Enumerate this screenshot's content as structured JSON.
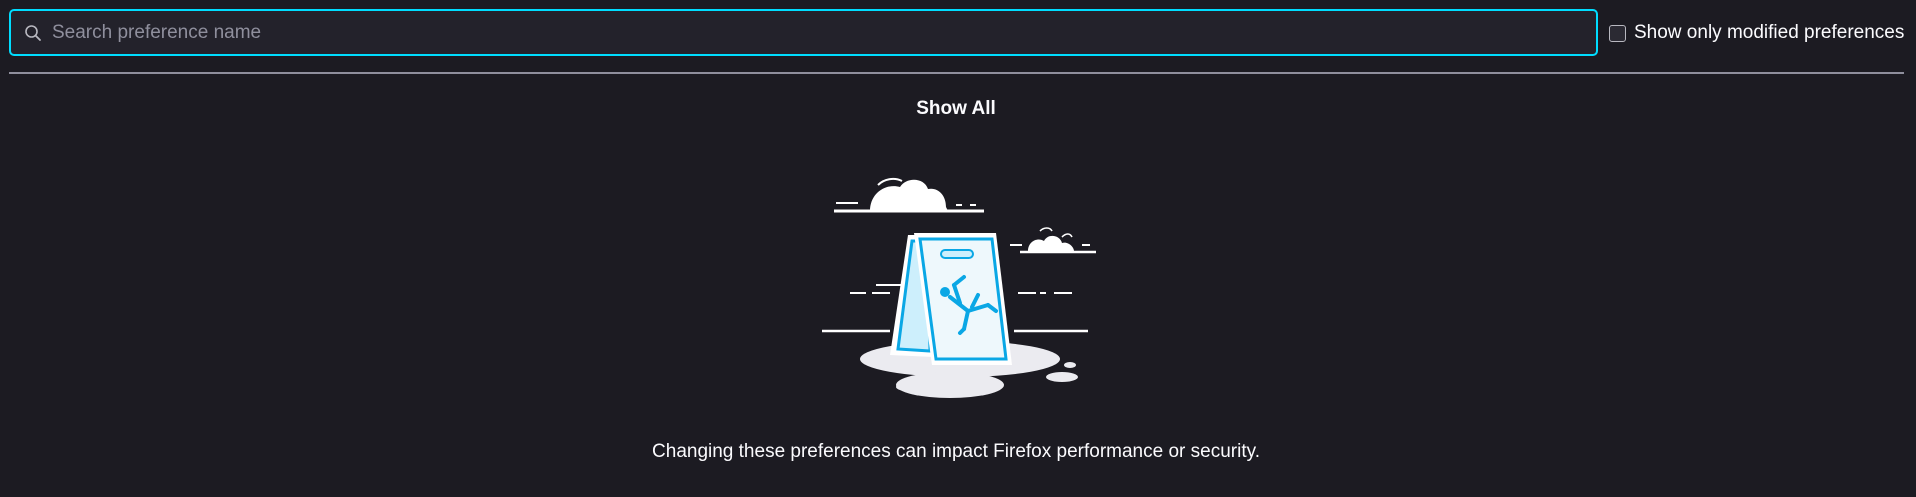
{
  "search": {
    "placeholder": "Search preference name",
    "value": ""
  },
  "filter": {
    "modified_only_label": "Show only modified preferences",
    "checked": false
  },
  "actions": {
    "show_all_label": "Show All"
  },
  "warning": {
    "text": "Changing these preferences can impact Firefox performance or security."
  },
  "colors": {
    "background": "#1c1b22",
    "accent": "#00ddff",
    "illustration_blue": "#0aa7e5"
  },
  "icons": {
    "search": "search-icon",
    "illustration": "caution-sign-illustration"
  }
}
